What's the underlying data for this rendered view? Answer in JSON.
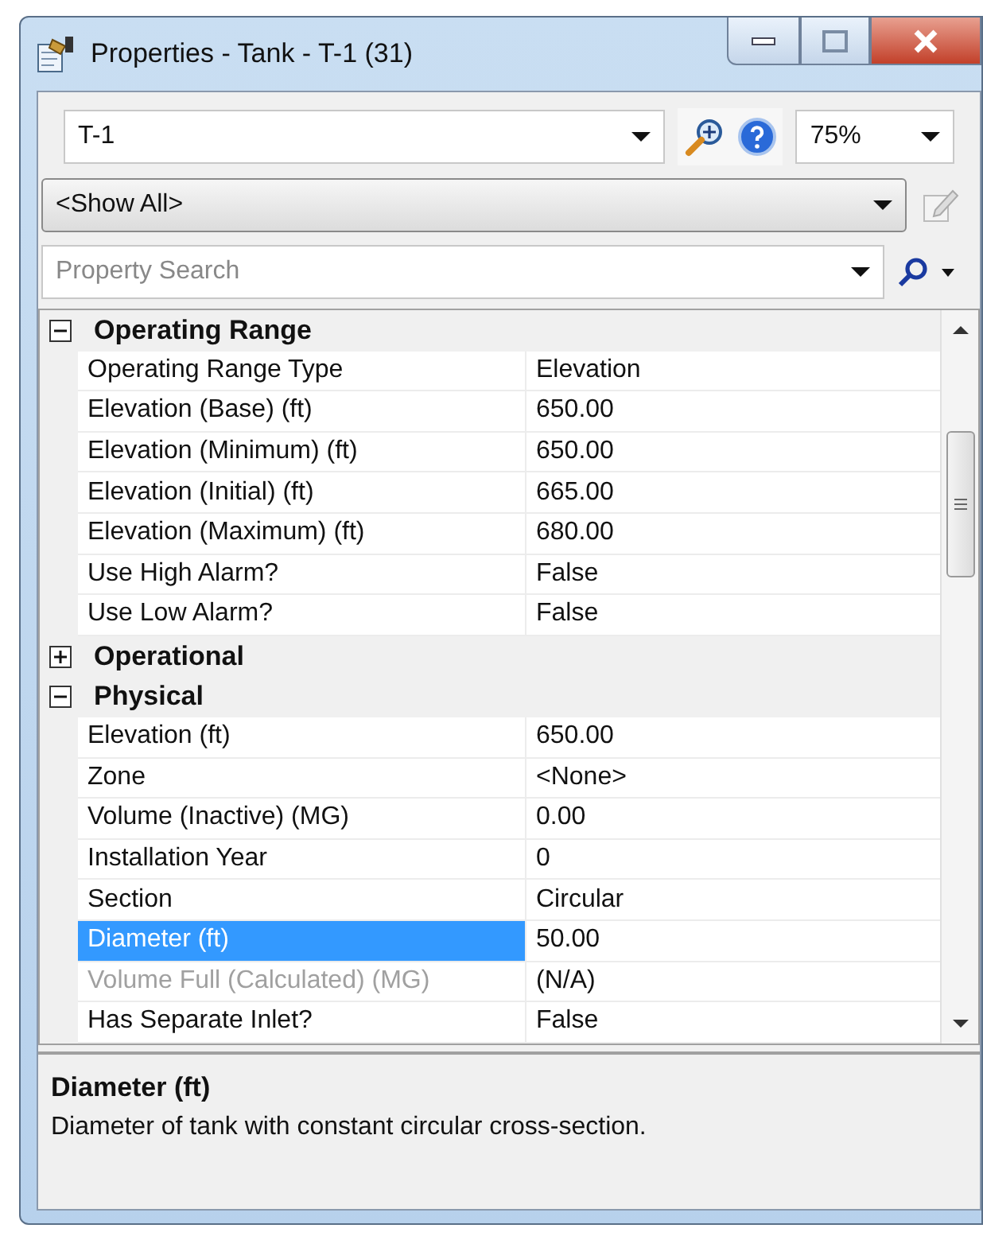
{
  "window": {
    "title": "Properties - Tank - T-1 (31)"
  },
  "object_select": {
    "value": "T-1"
  },
  "zoom_select": {
    "value": "75%"
  },
  "filter": {
    "value": "<Show All>"
  },
  "search": {
    "placeholder": "Property Search"
  },
  "categories": [
    {
      "name": "Operating Range",
      "expanded": true,
      "properties": [
        {
          "name": "Operating Range Type",
          "value": "Elevation",
          "selected": false,
          "disabled": false
        },
        {
          "name": "Elevation (Base) (ft)",
          "value": "650.00",
          "selected": false,
          "disabled": false
        },
        {
          "name": "Elevation (Minimum) (ft)",
          "value": "650.00",
          "selected": false,
          "disabled": false
        },
        {
          "name": "Elevation (Initial) (ft)",
          "value": "665.00",
          "selected": false,
          "disabled": false
        },
        {
          "name": "Elevation (Maximum) (ft)",
          "value": "680.00",
          "selected": false,
          "disabled": false
        },
        {
          "name": "Use High Alarm?",
          "value": "False",
          "selected": false,
          "disabled": false
        },
        {
          "name": "Use Low Alarm?",
          "value": "False",
          "selected": false,
          "disabled": false
        }
      ]
    },
    {
      "name": "Operational",
      "expanded": false
    },
    {
      "name": "Physical",
      "expanded": true,
      "properties": [
        {
          "name": "Elevation (ft)",
          "value": "650.00",
          "selected": false,
          "disabled": false
        },
        {
          "name": "Zone",
          "value": "<None>",
          "selected": false,
          "disabled": false
        },
        {
          "name": "Volume (Inactive) (MG)",
          "value": "0.00",
          "selected": false,
          "disabled": false
        },
        {
          "name": "Installation Year",
          "value": "0",
          "selected": false,
          "disabled": false
        },
        {
          "name": "Section",
          "value": "Circular",
          "selected": false,
          "disabled": false
        },
        {
          "name": "Diameter (ft)",
          "value": "50.00",
          "selected": true,
          "disabled": false
        },
        {
          "name": "Volume Full (Calculated) (MG)",
          "value": "(N/A)",
          "selected": false,
          "disabled": true
        },
        {
          "name": "Has Separate Inlet?",
          "value": "False",
          "selected": false,
          "disabled": false
        }
      ]
    }
  ],
  "description": {
    "title": "Diameter (ft)",
    "text": "Diameter of tank with constant circular cross-section."
  }
}
